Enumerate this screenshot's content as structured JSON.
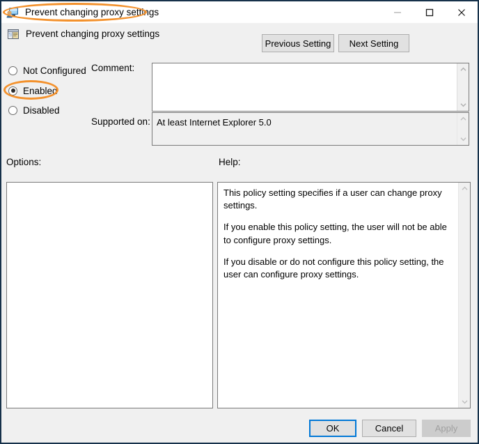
{
  "window": {
    "title": "Prevent changing proxy settings",
    "border_color": "#16314a",
    "titlebar_background": "#ffffff",
    "icons": {
      "title_icon": "computer-monitor-icon",
      "minimize": "minimize-icon",
      "maximize": "maximize-icon",
      "close": "close-icon"
    }
  },
  "header": {
    "icon": "group-policy-setting-icon",
    "title": "Prevent changing proxy settings"
  },
  "navigation": {
    "previous_label": "Previous Setting",
    "next_label": "Next Setting"
  },
  "state_options": [
    {
      "label": "Not Configured",
      "selected": false
    },
    {
      "label": "Enabled",
      "selected": true
    },
    {
      "label": "Disabled",
      "selected": false
    }
  ],
  "comment": {
    "label": "Comment:",
    "value": "",
    "placeholder": ""
  },
  "supported_on": {
    "label": "Supported on:",
    "value": "At least Internet Explorer 5.0"
  },
  "options": {
    "label": "Options:",
    "content": ""
  },
  "help": {
    "label": "Help:",
    "paragraphs": [
      "This policy setting specifies if a user can change proxy settings.",
      "If you enable this policy setting, the user will not be able to configure proxy settings.",
      "If you disable or do not configure this policy setting, the user can configure proxy settings."
    ],
    "paragraph_1": "This policy setting specifies if a user can change proxy settings.",
    "paragraph_2": "If you enable this policy setting, the user will not be able to configure proxy settings.",
    "paragraph_3": "If you disable or do not configure this policy setting, the user can configure proxy settings."
  },
  "footer": {
    "ok_label": "OK",
    "cancel_label": "Cancel",
    "apply_label": "Apply",
    "apply_disabled": true,
    "ok_focus_color": "#0078d7"
  },
  "annotations": {
    "color": "#f3912c",
    "highlighted": [
      "window-title",
      "enabled-radio-option"
    ]
  }
}
